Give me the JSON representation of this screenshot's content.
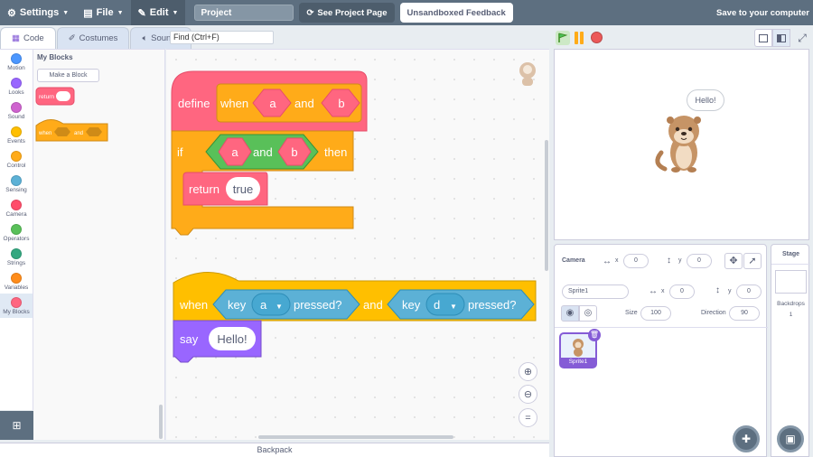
{
  "topbar": {
    "settings_label": "Settings",
    "file_label": "File",
    "edit_label": "Edit",
    "project_title": "Project",
    "see_project_label": "See Project Page",
    "feedback_label": "Unsandboxed Feedback",
    "save_label": "Save to your computer"
  },
  "tabs": [
    {
      "label": "Code",
      "icon": "code-icon"
    },
    {
      "label": "Costumes",
      "icon": "brush-icon"
    },
    {
      "label": "Sounds",
      "icon": "speaker-icon"
    }
  ],
  "find_placeholder": "Find (Ctrl+F)",
  "categories": [
    {
      "label": "Motion",
      "color": "#4c97ff"
    },
    {
      "label": "Looks",
      "color": "#9966ff"
    },
    {
      "label": "Sound",
      "color": "#cf63cf"
    },
    {
      "label": "Events",
      "color": "#ffbf00"
    },
    {
      "label": "Control",
      "color": "#ffab19"
    },
    {
      "label": "Sensing",
      "color": "#5cb1d6"
    },
    {
      "label": "Camera",
      "color": "#ff4d6a"
    },
    {
      "label": "Operators",
      "color": "#59c059"
    },
    {
      "label": "Strings",
      "color": "#33a880"
    },
    {
      "label": "Variables",
      "color": "#ff8c1a"
    },
    {
      "label": "My Blocks",
      "color": "#ff6680"
    }
  ],
  "flyout": {
    "title": "My Blocks",
    "make_block_label": "Make a Block",
    "return_label": "return",
    "when_label": "when",
    "and_label": "and"
  },
  "script1": {
    "define_label": "define",
    "when_label": "when",
    "param_a": "a",
    "and_label": "and",
    "param_b": "b",
    "if_label": "if",
    "then_label": "then",
    "return_label": "return",
    "return_value": "true"
  },
  "script2": {
    "when_label": "when",
    "key_label": "key",
    "key1_value": "a",
    "pressed_label": "pressed?",
    "and_label": "and",
    "key2_value": "d",
    "say_label": "say",
    "say_value": "Hello!"
  },
  "backpack_label": "Backpack",
  "stage": {
    "bubble_text": "Hello!"
  },
  "camera": {
    "label": "Camera",
    "x_label": "x",
    "x_value": "0",
    "y_label": "y",
    "y_value": "0"
  },
  "sprite": {
    "name": "Sprite1",
    "x_label": "x",
    "x_value": "0",
    "y_label": "y",
    "y_value": "0",
    "size_label": "Size",
    "size_value": "100",
    "direction_label": "Direction",
    "direction_value": "90",
    "thumb_label": "Sprite1"
  },
  "stage_panel": {
    "title": "Stage",
    "backdrops_label": "Backdrops",
    "backdrops_count": "1"
  },
  "colors": {
    "topbar": "#5d6f80",
    "myblocks": "#ff6680",
    "control": "#ffab19",
    "operators": "#59c059",
    "sensing": "#5cb1d6",
    "looks": "#9966ff",
    "events": "#ffbf00"
  }
}
